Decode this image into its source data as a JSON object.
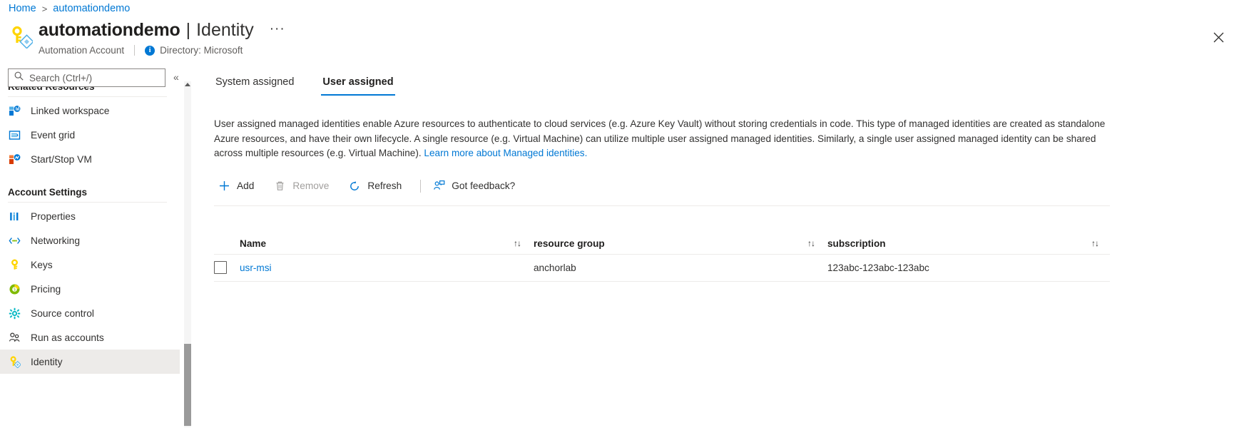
{
  "breadcrumb": {
    "home": "Home",
    "separator": ">",
    "current": "automationdemo"
  },
  "header": {
    "resource_icon": "key-identity-icon",
    "title": "automationdemo",
    "pipe": "|",
    "section": "Identity",
    "more_label": "···",
    "resource_type": "Automation Account",
    "info_icon": "info-icon",
    "directory": "Directory: Microsoft",
    "close_icon": "close-icon"
  },
  "sidebar": {
    "search": {
      "placeholder": "Search (Ctrl+/)",
      "value": "",
      "icon": "search-icon"
    },
    "collapse_icon": "«",
    "sections": [
      {
        "title": "Related Resources",
        "items": [
          {
            "label": "Linked workspace",
            "icon": "linked-workspace-icon",
            "selected": false
          },
          {
            "label": "Event grid",
            "icon": "event-grid-icon",
            "selected": false
          },
          {
            "label": "Start/Stop VM",
            "icon": "start-stop-vm-icon",
            "selected": false
          }
        ]
      },
      {
        "title": "Account Settings",
        "items": [
          {
            "label": "Properties",
            "icon": "properties-icon",
            "selected": false
          },
          {
            "label": "Networking",
            "icon": "networking-icon",
            "selected": false
          },
          {
            "label": "Keys",
            "icon": "keys-icon",
            "selected": false
          },
          {
            "label": "Pricing",
            "icon": "pricing-icon",
            "selected": false
          },
          {
            "label": "Source control",
            "icon": "source-control-icon",
            "selected": false
          },
          {
            "label": "Run as accounts",
            "icon": "run-as-accounts-icon",
            "selected": false
          },
          {
            "label": "Identity",
            "icon": "identity-icon",
            "selected": true
          }
        ]
      }
    ]
  },
  "main": {
    "tabs": [
      {
        "label": "System assigned",
        "active": false
      },
      {
        "label": "User assigned",
        "active": true
      }
    ],
    "description": {
      "text_before_link": "User assigned managed identities enable Azure resources to authenticate to cloud services (e.g. Azure Key Vault) without storing credentials in code. This type of managed identities are created as standalone Azure resources, and have their own lifecycle. A single resource (e.g. Virtual Machine) can utilize multiple user assigned managed identities. Similarly, a single user assigned managed identity can be shared across multiple resources (e.g. Virtual Machine). ",
      "link_text": "Learn more about Managed identities.",
      "text_after_link": ""
    },
    "toolbar": [
      {
        "label": "Add",
        "icon": "plus-icon",
        "disabled": false
      },
      {
        "label": "Remove",
        "icon": "trash-icon",
        "disabled": true
      },
      {
        "label": "Refresh",
        "icon": "refresh-icon",
        "disabled": false
      },
      {
        "label": "Got feedback?",
        "icon": "feedback-person-icon",
        "disabled": false
      }
    ],
    "table": {
      "columns": [
        {
          "label": "Name",
          "sort_icon": "sort-arrows-icon"
        },
        {
          "label": "resource group",
          "sort_icon": "sort-arrows-icon"
        },
        {
          "label": "subscription",
          "sort_icon": "sort-arrows-icon"
        }
      ],
      "rows": [
        {
          "checked": false,
          "name": "usr-msi",
          "resource_group": "anchorlab",
          "subscription": "123abc-123abc-123abc"
        }
      ]
    }
  },
  "colors": {
    "accent": "#0078d4",
    "link": "#0078d4",
    "text": "#323130",
    "muted": "#605e5c",
    "disabled": "#a19f9d",
    "selected_bg": "#edebe9",
    "rule": "#edebe9"
  }
}
